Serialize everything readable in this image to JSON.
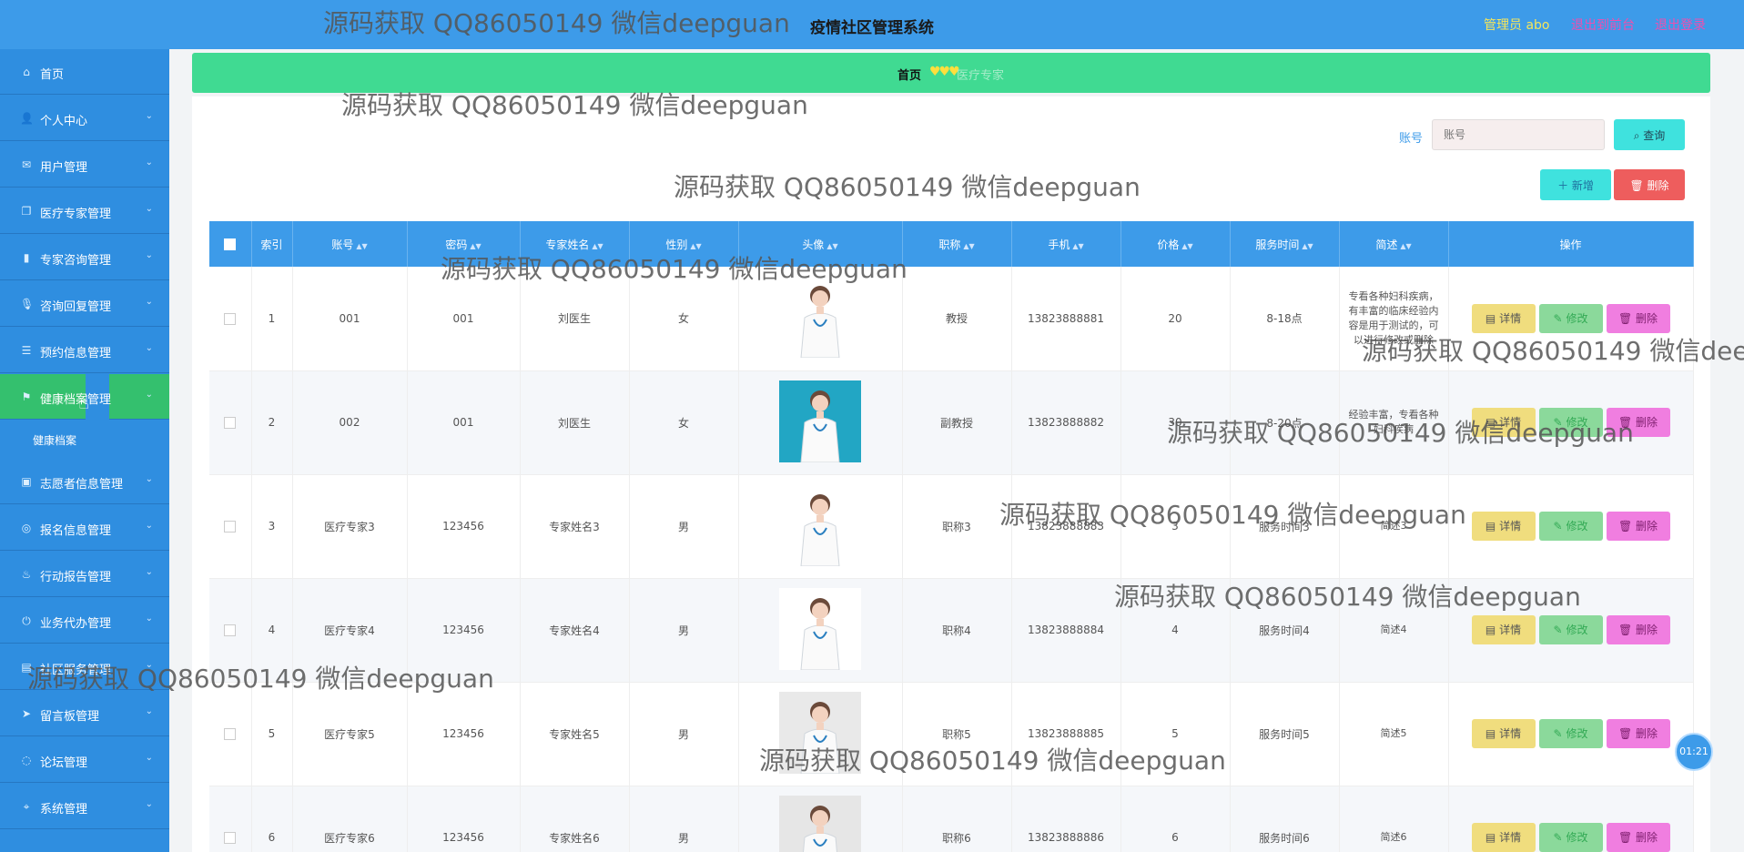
{
  "header": {
    "title": "疫情社区管理系统",
    "admin": "管理员 abo",
    "back_front": "退出到前台",
    "logout": "退出登录"
  },
  "sidebar": {
    "items": [
      {
        "label": "首页",
        "icon": "home-icon",
        "chevron": false
      },
      {
        "label": "个人中心",
        "icon": "user-icon",
        "chevron": true
      },
      {
        "label": "用户管理",
        "icon": "mail-icon",
        "chevron": true
      },
      {
        "label": "医疗专家管理",
        "icon": "copy-icon",
        "chevron": true
      },
      {
        "label": "专家咨询管理",
        "icon": "bar-chart-icon",
        "chevron": true
      },
      {
        "label": "咨询回复管理",
        "icon": "mic-icon",
        "chevron": true
      },
      {
        "label": "预约信息管理",
        "icon": "sliders-icon",
        "chevron": true
      },
      {
        "label": "健康档案管理",
        "icon": "flag-icon",
        "chevron": true,
        "active": true
      },
      {
        "label": "志愿者信息管理",
        "icon": "briefcase-icon",
        "chevron": true
      },
      {
        "label": "报名信息管理",
        "icon": "eye-slash-icon",
        "chevron": true
      },
      {
        "label": "行动报告管理",
        "icon": "cup-icon",
        "chevron": true
      },
      {
        "label": "业务代办管理",
        "icon": "power-icon",
        "chevron": true
      },
      {
        "label": "社区服务管理",
        "icon": "folder-icon",
        "chevron": true
      },
      {
        "label": "留言板管理",
        "icon": "send-icon",
        "chevron": true
      },
      {
        "label": "论坛管理",
        "icon": "circle-icon",
        "chevron": true
      },
      {
        "label": "系统管理",
        "icon": "pin-icon",
        "chevron": true
      }
    ],
    "submenu": {
      "label": "健康档案"
    }
  },
  "breadcrumb": {
    "home": "首页",
    "current": "医疗专家"
  },
  "search": {
    "label": "账号",
    "placeholder": "账号",
    "query_button": "查询"
  },
  "toolbar": {
    "add": "新增",
    "delete": "删除"
  },
  "table": {
    "headers": [
      "索引",
      "账号",
      "密码",
      "专家姓名",
      "性别",
      "头像",
      "职称",
      "手机",
      "价格",
      "服务时间",
      "简述",
      "操作"
    ],
    "rows": [
      {
        "idx": "1",
        "account": "001",
        "password": "001",
        "name": "刘医生",
        "gender": "女",
        "title": "教授",
        "phone": "13823888881",
        "price": "20",
        "time": "8-18点",
        "desc": "专看各种妇科疾病，有丰富的临床经验内容是用于测试的，可以进行修改或删除"
      },
      {
        "idx": "2",
        "account": "002",
        "password": "001",
        "name": "刘医生",
        "gender": "女",
        "title": "副教授",
        "phone": "13823888882",
        "price": "30",
        "time": "8-20点",
        "desc": "经验丰富，专看各种妇科疾病"
      },
      {
        "idx": "3",
        "account": "医疗专家3",
        "password": "123456",
        "name": "专家姓名3",
        "gender": "男",
        "title": "职称3",
        "phone": "13823888883",
        "price": "3",
        "time": "服务时间3",
        "desc": "简述3"
      },
      {
        "idx": "4",
        "account": "医疗专家4",
        "password": "123456",
        "name": "专家姓名4",
        "gender": "男",
        "title": "职称4",
        "phone": "13823888884",
        "price": "4",
        "time": "服务时间4",
        "desc": "简述4"
      },
      {
        "idx": "5",
        "account": "医疗专家5",
        "password": "123456",
        "name": "专家姓名5",
        "gender": "男",
        "title": "职称5",
        "phone": "13823888885",
        "price": "5",
        "time": "服务时间5",
        "desc": "简述5"
      },
      {
        "idx": "6",
        "account": "医疗专家6",
        "password": "123456",
        "name": "专家姓名6",
        "gender": "男",
        "title": "职称6",
        "phone": "13823888886",
        "price": "6",
        "time": "服务时间6",
        "desc": "简述6"
      }
    ],
    "actions": {
      "detail": "详情",
      "edit": "修改",
      "delete": "删除"
    }
  },
  "timer": "01:21",
  "watermark": "源码获取 QQ86050149 微信deepguan",
  "colors": {
    "header": "#3d9be9",
    "sidebar": "#2f8ee0",
    "active_menu": "#34c06e",
    "breadcrumb": "#40da92",
    "query_button": "#3fe2de",
    "delete_button": "#ee5d5d"
  }
}
